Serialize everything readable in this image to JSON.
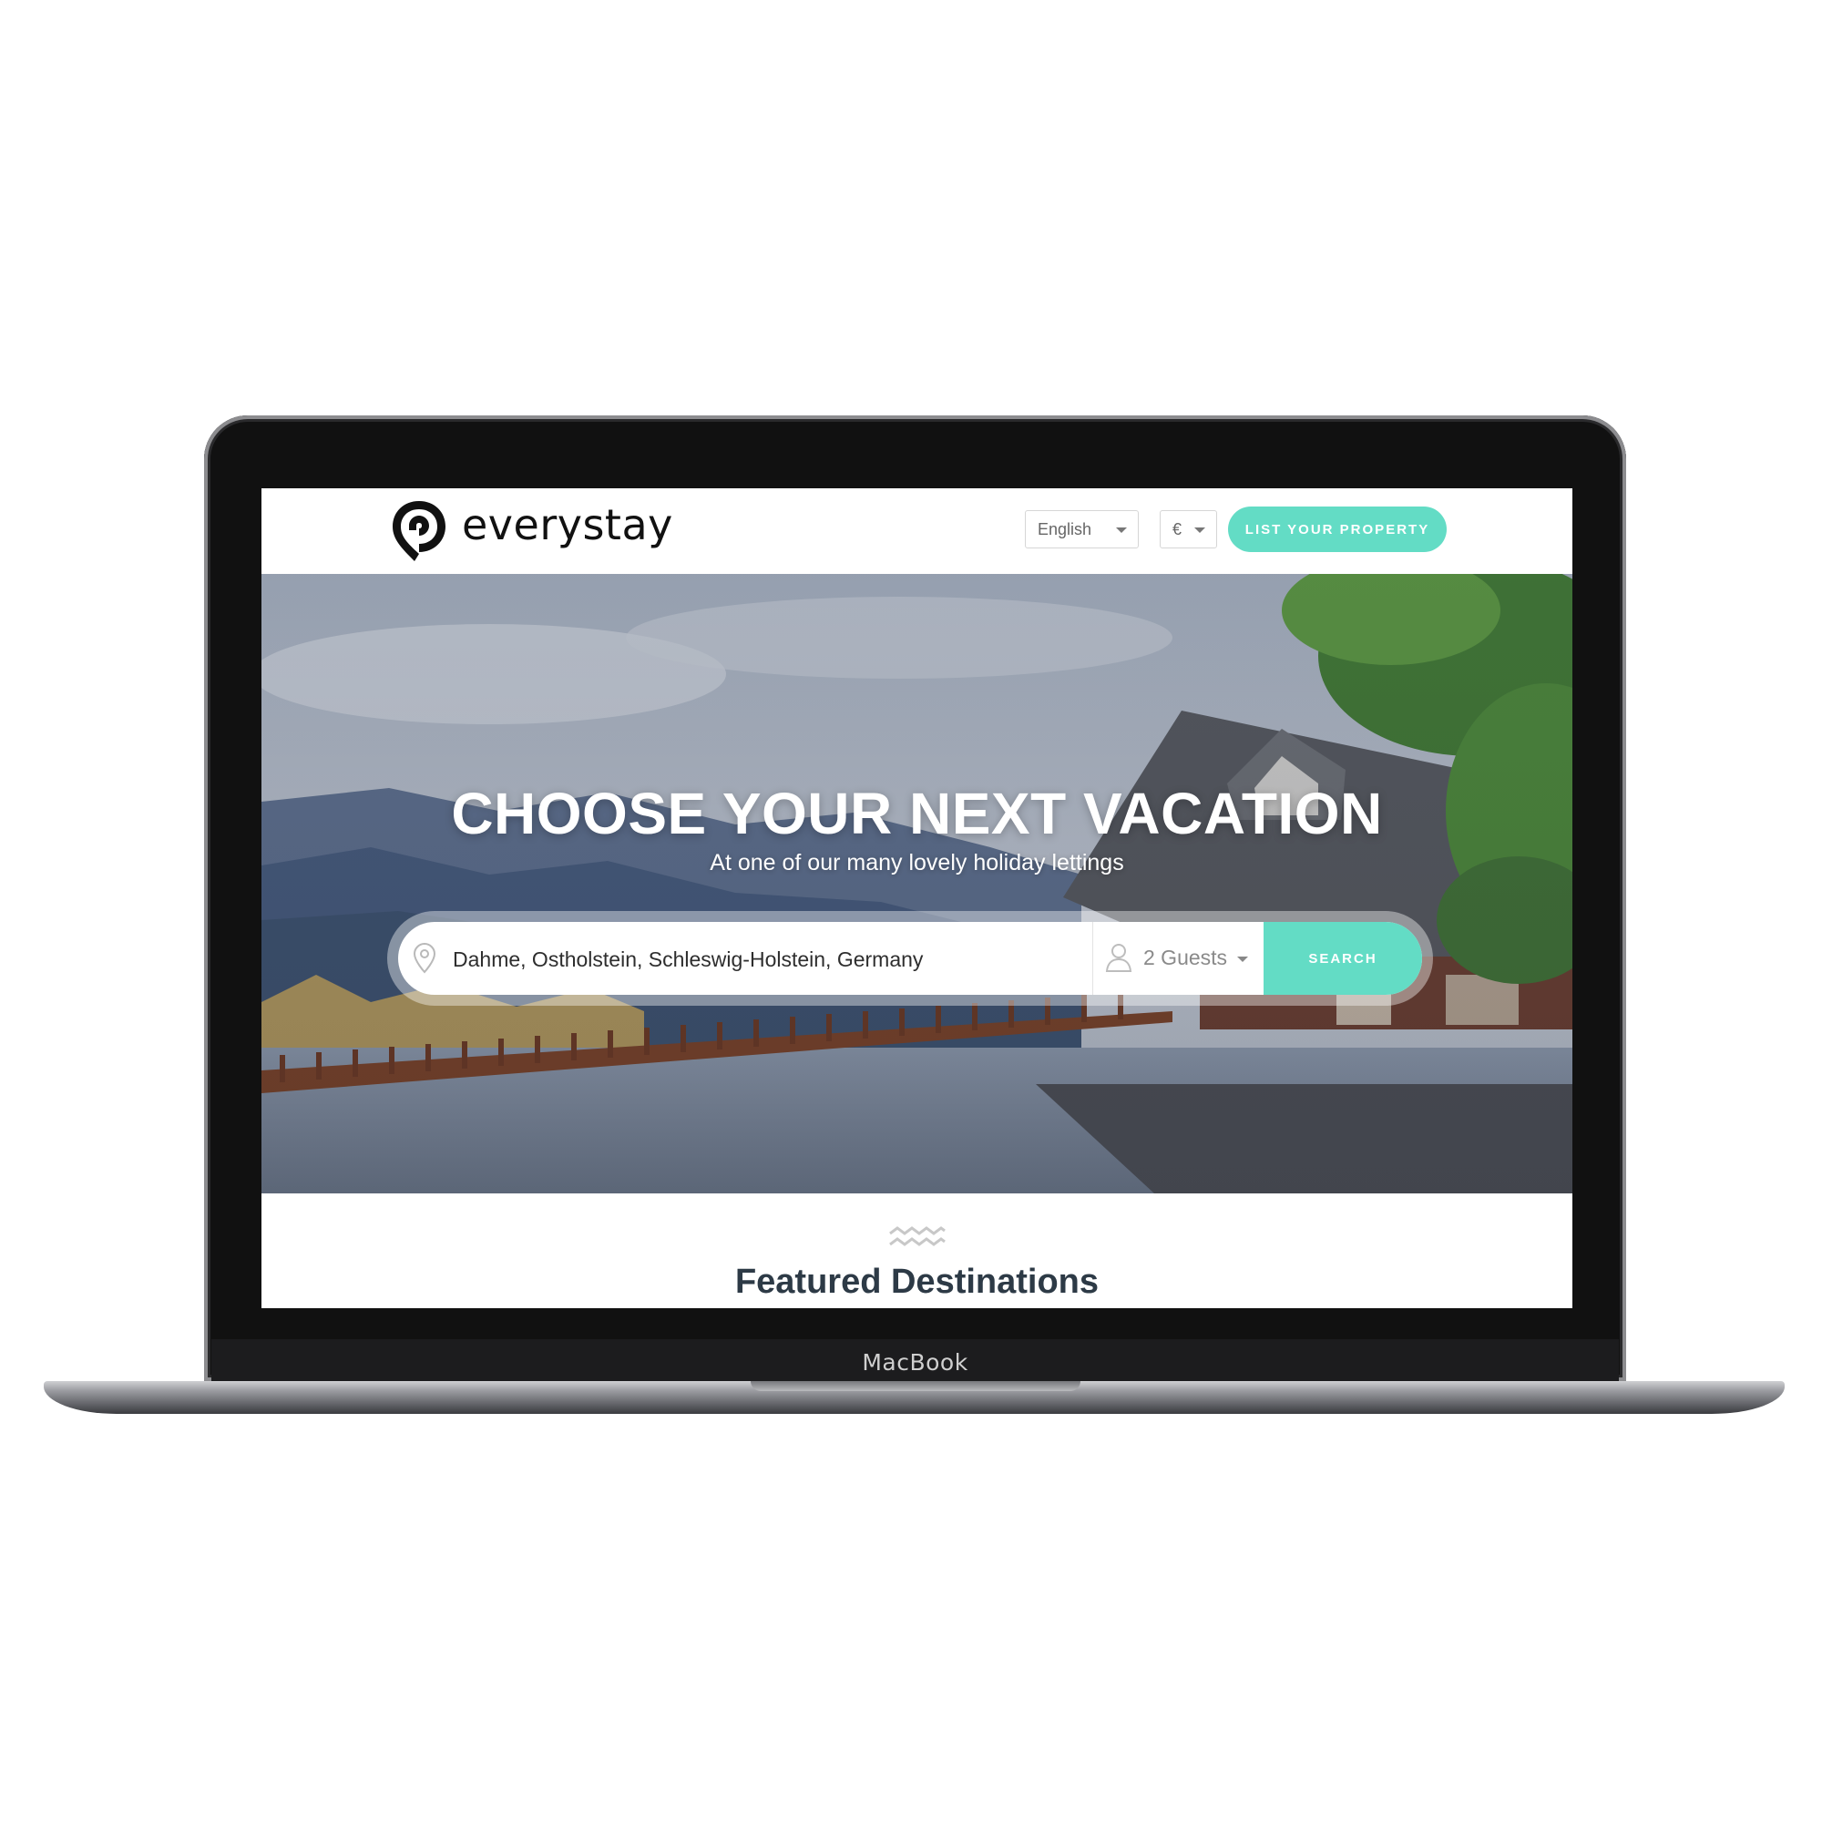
{
  "device": {
    "brand": "MacBook"
  },
  "header": {
    "logo_text": "everystay",
    "language": {
      "selected": "English"
    },
    "currency": {
      "selected": "€"
    },
    "list_property_label": "LIST YOUR PROPERTY"
  },
  "hero": {
    "title": "CHOOSE YOUR NEXT VACATION",
    "subtitle": "At one of our many lovely holiday lettings"
  },
  "search": {
    "location_value": "Dahme, Ostholstein, Schleswig-Holstein, Germany",
    "guests": "2 Guests",
    "button_label": "SEARCH"
  },
  "section": {
    "featured_title": "Featured Destinations"
  },
  "colors": {
    "accent": "#63dcc5",
    "heading": "#2d3a46",
    "bezel": "#111111"
  },
  "icons": [
    "location-pin-icon",
    "guest-icon",
    "chevron-down-icon",
    "wave-icon",
    "logo-pin-icon"
  ]
}
